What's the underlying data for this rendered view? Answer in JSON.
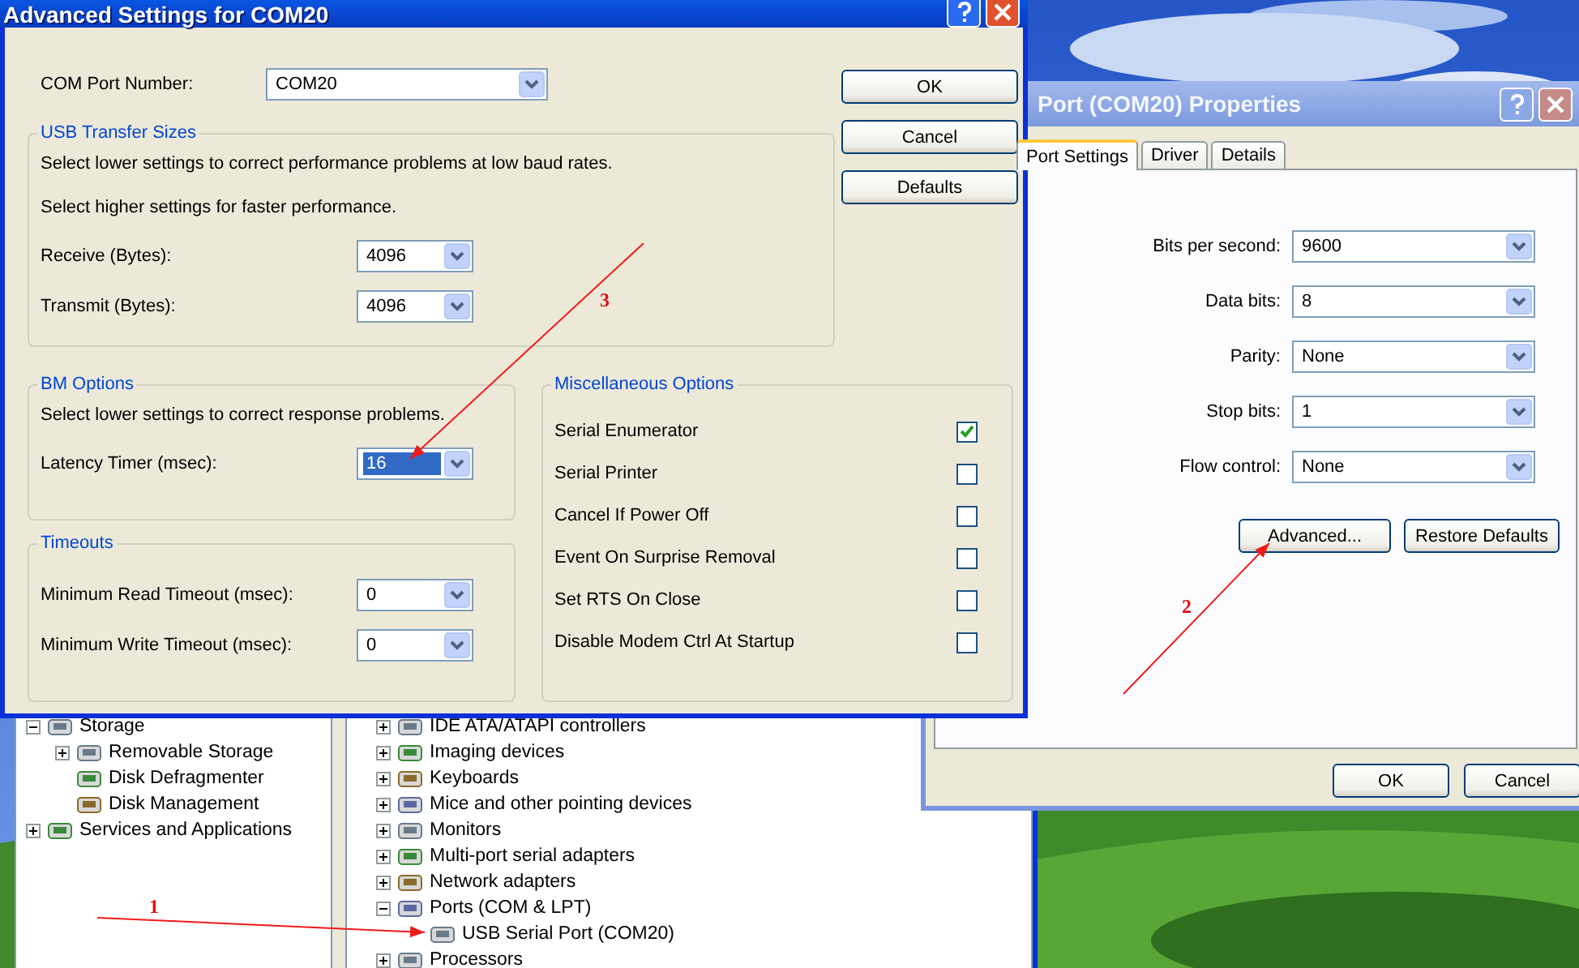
{
  "advanced_dialog": {
    "title": "Advanced Settings for COM20",
    "com_port": {
      "label": "COM Port Number:",
      "value": "COM20"
    },
    "buttons": [
      "OK",
      "Cancel",
      "Defaults"
    ],
    "usb_transfer": {
      "title": "USB Transfer Sizes",
      "notes": [
        "Select lower settings to correct performance problems at low baud rates.",
        "Select higher settings for faster performance."
      ],
      "fields": [
        {
          "label": "Receive (Bytes):",
          "value": "4096",
          "selected": false
        },
        {
          "label": "Transmit (Bytes):",
          "value": "4096",
          "selected": false
        }
      ]
    },
    "bm_options": {
      "title": "BM Options",
      "notes": [
        "Select lower settings to correct response problems."
      ],
      "fields": [
        {
          "label": "Latency Timer (msec):",
          "value": "16",
          "selected": true
        }
      ]
    },
    "timeouts": {
      "title": "Timeouts",
      "fields": [
        {
          "label": "Minimum Read Timeout (msec):",
          "value": "0",
          "selected": false
        },
        {
          "label": "Minimum Write Timeout (msec):",
          "value": "0",
          "selected": false
        }
      ]
    },
    "misc": {
      "title": "Miscellaneous Options",
      "options": [
        {
          "label": "Serial Enumerator",
          "checked": true
        },
        {
          "label": "Serial Printer",
          "checked": false
        },
        {
          "label": "Cancel If Power Off",
          "checked": false
        },
        {
          "label": "Event On Surprise Removal",
          "checked": false
        },
        {
          "label": "Set RTS On Close",
          "checked": false
        },
        {
          "label": "Disable Modem Ctrl At Startup",
          "checked": false
        }
      ]
    }
  },
  "properties_dialog": {
    "title": "Port (COM20) Properties",
    "tabs": [
      {
        "label": "Port Settings",
        "selected": true
      },
      {
        "label": "Driver",
        "selected": false
      },
      {
        "label": "Details",
        "selected": false
      }
    ],
    "fields": [
      {
        "label": "Bits per second:",
        "value": "9600"
      },
      {
        "label": "Data bits:",
        "value": "8"
      },
      {
        "label": "Parity:",
        "value": "None"
      },
      {
        "label": "Stop bits:",
        "value": "1"
      },
      {
        "label": "Flow control:",
        "value": "None"
      }
    ],
    "panel_buttons": [
      "Advanced...",
      "Restore Defaults"
    ],
    "buttons": [
      "OK",
      "Cancel"
    ]
  },
  "device_manager": {
    "left_tree": [
      {
        "label": "Storage",
        "expanded": true,
        "children": [
          {
            "label": "Removable Storage",
            "expanded": false
          },
          {
            "label": "Disk Defragmenter"
          },
          {
            "label": "Disk Management"
          }
        ]
      },
      {
        "label": "Services and Applications",
        "expanded": false
      }
    ],
    "right_tree": [
      {
        "label": "IDE ATA/ATAPI controllers",
        "expanded": false
      },
      {
        "label": "Imaging devices",
        "expanded": false
      },
      {
        "label": "Keyboards",
        "expanded": false
      },
      {
        "label": "Mice and other pointing devices",
        "expanded": false
      },
      {
        "label": "Monitors",
        "expanded": false
      },
      {
        "label": "Multi-port serial adapters",
        "expanded": false
      },
      {
        "label": "Network adapters",
        "expanded": false
      },
      {
        "label": "Ports (COM & LPT)",
        "expanded": true,
        "children": [
          {
            "label": "USB Serial Port (COM20)"
          }
        ]
      },
      {
        "label": "Processors",
        "expanded": false
      }
    ]
  },
  "annotations": [
    {
      "label": "1"
    },
    {
      "label": "2"
    },
    {
      "label": "3"
    }
  ]
}
